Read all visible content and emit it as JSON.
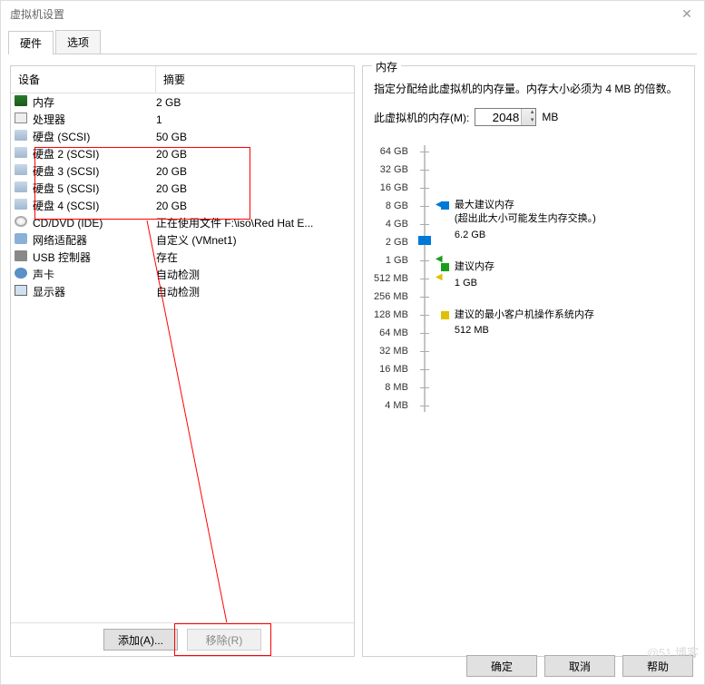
{
  "window": {
    "title": "虚拟机设置"
  },
  "tabs": [
    {
      "label": "硬件",
      "active": true
    },
    {
      "label": "选项",
      "active": false
    }
  ],
  "grid": {
    "headers": {
      "device": "设备",
      "summary": "摘要"
    },
    "rows": [
      {
        "icon": "ic-mem",
        "name": "内存",
        "summary": "2 GB"
      },
      {
        "icon": "ic-cpu",
        "name": "处理器",
        "summary": "1"
      },
      {
        "icon": "ic-disk",
        "name": "硬盘 (SCSI)",
        "summary": "50 GB"
      },
      {
        "icon": "ic-disk",
        "name": "硬盘 2 (SCSI)",
        "summary": "20 GB"
      },
      {
        "icon": "ic-disk",
        "name": "硬盘 3 (SCSI)",
        "summary": "20 GB"
      },
      {
        "icon": "ic-disk",
        "name": "硬盘 5 (SCSI)",
        "summary": "20 GB"
      },
      {
        "icon": "ic-disk",
        "name": "硬盘 4 (SCSI)",
        "summary": "20 GB"
      },
      {
        "icon": "ic-cd",
        "name": "CD/DVD (IDE)",
        "summary": "正在使用文件 F:\\iso\\Red Hat E..."
      },
      {
        "icon": "ic-net",
        "name": "网络适配器",
        "summary": "自定义 (VMnet1)"
      },
      {
        "icon": "ic-usb",
        "name": "USB 控制器",
        "summary": "存在"
      },
      {
        "icon": "ic-snd",
        "name": "声卡",
        "summary": "自动检测"
      },
      {
        "icon": "ic-disp",
        "name": "显示器",
        "summary": "自动检测"
      }
    ]
  },
  "buttons": {
    "add": "添加(A)...",
    "remove": "移除(R)",
    "ok": "确定",
    "cancel": "取消",
    "help": "帮助"
  },
  "memory": {
    "title": "内存",
    "desc": "指定分配给此虚拟机的内存量。内存大小必须为 4 MB 的倍数。",
    "label": "此虚拟机的内存(M):",
    "value": "2048",
    "unit": "MB",
    "ticks": [
      "64 GB",
      "32 GB",
      "16 GB",
      "8 GB",
      "4 GB",
      "2 GB",
      "1 GB",
      "512 MB",
      "256 MB",
      "128 MB",
      "64 MB",
      "32 MB",
      "16 MB",
      "8 MB",
      "4 MB"
    ],
    "legend": {
      "max": {
        "label": "最大建议内存",
        "note": "(超出此大小可能发生内存交换。)",
        "value": "6.2 GB"
      },
      "rec": {
        "label": "建议内存",
        "value": "1 GB"
      },
      "min": {
        "label": "建议的最小客户机操作系统内存",
        "value": "512 MB"
      }
    }
  },
  "watermark": "@51         博客"
}
